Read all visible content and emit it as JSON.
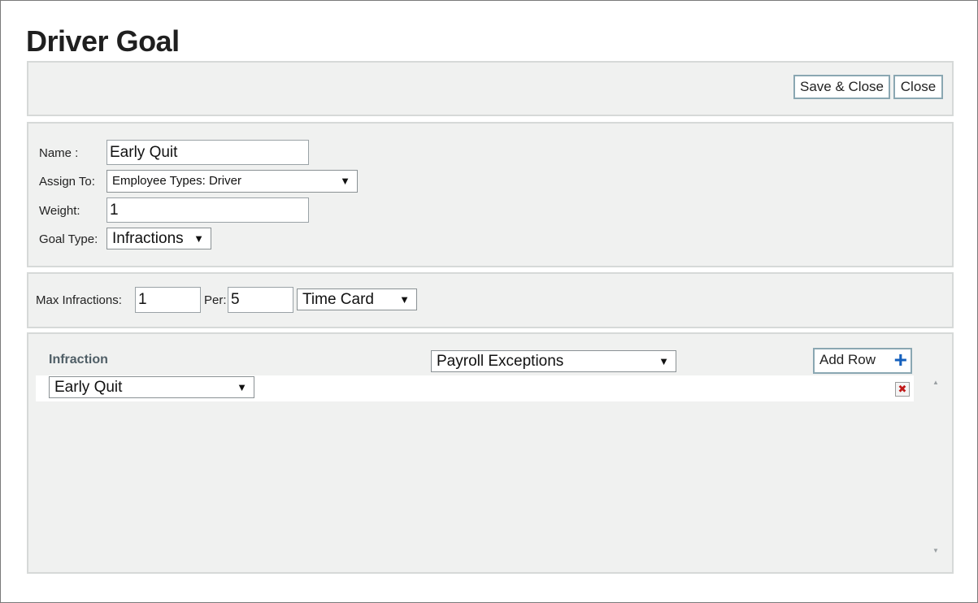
{
  "page": {
    "title": "Driver Goal"
  },
  "toolbar": {
    "save_close_label": "Save & Close",
    "close_label": "Close"
  },
  "form": {
    "name_label": "Name :",
    "name_value": "Early Quit",
    "assign_label": "Assign To:",
    "assign_value": "Employee Types: Driver",
    "weight_label": "Weight:",
    "weight_value": "1",
    "goal_type_label": "Goal Type:",
    "goal_type_value": "Infractions"
  },
  "limits": {
    "max_label": "Max Infractions:",
    "max_value": "1",
    "per_label": "Per:",
    "per_value": "5",
    "unit_value": "Time Card"
  },
  "grid": {
    "header_label": "Infraction",
    "category_value": "Payroll Exceptions",
    "add_row_label": "Add Row",
    "rows": [
      {
        "infraction": "Early Quit"
      }
    ]
  },
  "icons": {
    "dropdown": "caret-down-icon",
    "add": "plus-icon",
    "delete": "delete-x-icon",
    "scroll_up": "scroll-up-icon",
    "scroll_down": "scroll-down-icon"
  },
  "colors": {
    "panel_bg": "#f0f1f0",
    "button_border": "#8aa7b2",
    "add_icon": "#1560bd",
    "delete_icon": "#c01818",
    "grid_header": "#4f5e66"
  }
}
